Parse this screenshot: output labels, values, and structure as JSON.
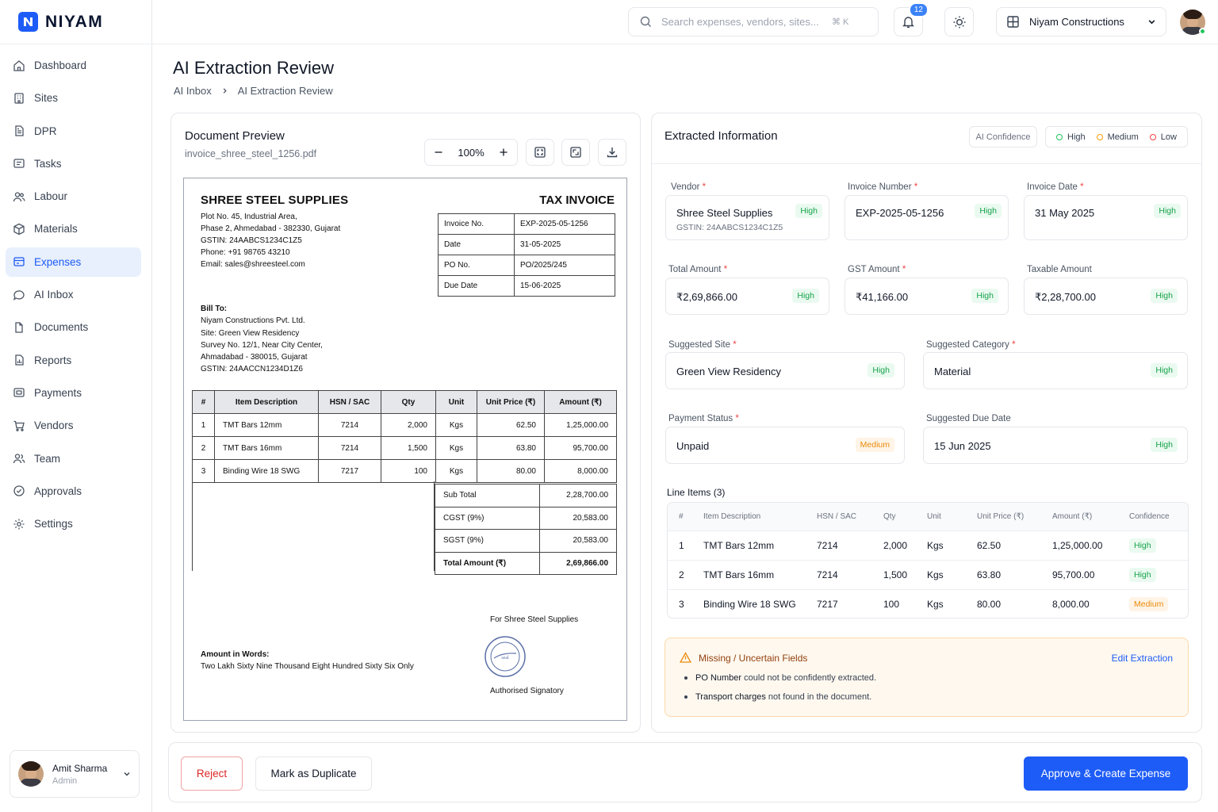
{
  "app": {
    "logo_text": "NIYAM"
  },
  "sidebar": {
    "items": [
      {
        "label": "Dashboard"
      },
      {
        "label": "Sites"
      },
      {
        "label": "DPR"
      },
      {
        "label": "Tasks"
      },
      {
        "label": "Labour"
      },
      {
        "label": "Materials"
      },
      {
        "label": "Expenses",
        "active": true
      },
      {
        "label": "AI Inbox"
      },
      {
        "label": "Documents"
      },
      {
        "label": "Reports"
      },
      {
        "label": "Payments"
      },
      {
        "label": "Vendors"
      },
      {
        "label": "Team"
      },
      {
        "label": "Approvals"
      },
      {
        "label": "Settings"
      }
    ],
    "user": {
      "name": "Amit Sharma",
      "role": "Admin"
    }
  },
  "topbar": {
    "search_placeholder": "Search expenses, vendors, sites...",
    "search_shortcut": "⌘ K",
    "notification_count": "12",
    "org_name": "Niyam Constructions"
  },
  "page": {
    "title": "AI Extraction Review",
    "breadcrumb": [
      "AI Inbox",
      "AI Extraction Review"
    ]
  },
  "preview": {
    "title": "Document Preview",
    "file_name": "invoice_shree_steel_1256.pdf",
    "zoom": "100%"
  },
  "invoice": {
    "company": "SHREE STEEL SUPPLIES",
    "doc_title": "TAX INVOICE",
    "address_lines": [
      "Plot No. 45, Industrial Area,",
      "Phase 2, Ahmedabad - 382330, Gujarat",
      "GSTIN: 24AABCS1234C1Z5",
      "Phone: +91 98765 43210",
      "Email: sales@shreesteel.com"
    ],
    "meta": [
      {
        "label": "Invoice No.",
        "value": "EXP-2025-05-1256"
      },
      {
        "label": "Date",
        "value": "31-05-2025"
      },
      {
        "label": "PO No.",
        "value": "PO/2025/245"
      },
      {
        "label": "Due Date",
        "value": "15-06-2025"
      }
    ],
    "bill_to_label": "Bill To:",
    "bill_to_lines": [
      "Niyam Constructions Pvt. Ltd.",
      "Site: Green View Residency",
      "Survey No. 12/1, Near City Center,",
      "Ahmadabad - 380015, Gujarat",
      "GSTIN: 24AACCN1234D1Z6"
    ],
    "item_headers": [
      "#",
      "Item Description",
      "HSN / SAC",
      "Qty",
      "Unit",
      "Unit Price (₹)",
      "Amount (₹)"
    ],
    "items": [
      [
        "1",
        "TMT Bars 12mm",
        "7214",
        "2,000",
        "Kgs",
        "62.50",
        "1,25,000.00"
      ],
      [
        "2",
        "TMT Bars 16mm",
        "7214",
        "1,500",
        "Kgs",
        "63.80",
        "95,700.00"
      ],
      [
        "3",
        "Binding Wire 18 SWG",
        "7217",
        "100",
        "Kgs",
        "80.00",
        "8,000.00"
      ]
    ],
    "totals": [
      {
        "label": "Sub Total",
        "value": "2,28,700.00"
      },
      {
        "label": "CGST (9%)",
        "value": "20,583.00"
      },
      {
        "label": "SGST (9%)",
        "value": "20,583.00"
      },
      {
        "label": "Total Amount (₹)",
        "value": "2,69,866.00"
      }
    ],
    "for_company": "For Shree Steel Supplies",
    "signatory": "Authorised Signatory",
    "words_label": "Amount in Words:",
    "words_value": "Two Lakh Sixty Nine Thousand Eight Hundred Sixty Six Only"
  },
  "extracted": {
    "title": "Extracted Information",
    "confidence_label": "AI Confidence",
    "legend": [
      {
        "label": "High",
        "color": "#22c55e"
      },
      {
        "label": "Medium",
        "color": "#f59e0b"
      },
      {
        "label": "Low",
        "color": "#ef4444"
      }
    ],
    "fields": {
      "vendor": {
        "label": "Vendor",
        "value": "Shree Steel Supplies",
        "sub": "GSTIN: 24AABCS1234C1Z5",
        "confidence": "High"
      },
      "invoice_number": {
        "label": "Invoice Number",
        "value": "EXP-2025-05-1256",
        "confidence": "High"
      },
      "invoice_date": {
        "label": "Invoice Date",
        "value": "31 May 2025",
        "confidence": "High"
      },
      "total_amount": {
        "label": "Total Amount",
        "value": "₹2,69,866.00",
        "confidence": "High"
      },
      "gst_amount": {
        "label": "GST Amount",
        "value": "₹41,166.00",
        "confidence": "High"
      },
      "taxable_amount": {
        "label": "Taxable Amount",
        "value": "₹2,28,700.00",
        "confidence": "High"
      },
      "suggested_site": {
        "label": "Suggested Site",
        "value": "Green View Residency",
        "confidence": "High"
      },
      "suggested_category": {
        "label": "Suggested Category",
        "value": "Material",
        "confidence": "High"
      },
      "payment_status": {
        "label": "Payment Status",
        "value": "Unpaid",
        "confidence": "Medium"
      },
      "suggested_due_date": {
        "label": "Suggested Due Date",
        "value": "15 Jun 2025",
        "confidence": "High"
      }
    },
    "line_items_title": "Line Items (3)",
    "line_headers": [
      "#",
      "Item Description",
      "HSN / SAC",
      "Qty",
      "Unit",
      "Unit Price (₹)",
      "Amount (₹)",
      "Confidence"
    ],
    "line_items": [
      [
        "1",
        "TMT Bars 12mm",
        "7214",
        "2,000",
        "Kgs",
        "62.50",
        "1,25,000.00",
        "High"
      ],
      [
        "2",
        "TMT Bars 16mm",
        "7214",
        "1,500",
        "Kgs",
        "63.80",
        "95,700.00",
        "High"
      ],
      [
        "3",
        "Binding Wire 18 SWG",
        "7217",
        "100",
        "Kgs",
        "80.00",
        "8,000.00",
        "Medium"
      ]
    ],
    "warning": {
      "title": "Missing / Uncertain Fields",
      "edit_label": "Edit Extraction",
      "items": [
        {
          "bold": "PO Number",
          "text": " could not be confidently extracted."
        },
        {
          "bold": "Transport charges",
          "text": " not found in the document."
        }
      ]
    }
  },
  "actions": {
    "reject": "Reject",
    "duplicate": "Mark as Duplicate",
    "approve": "Approve & Create Expense"
  }
}
